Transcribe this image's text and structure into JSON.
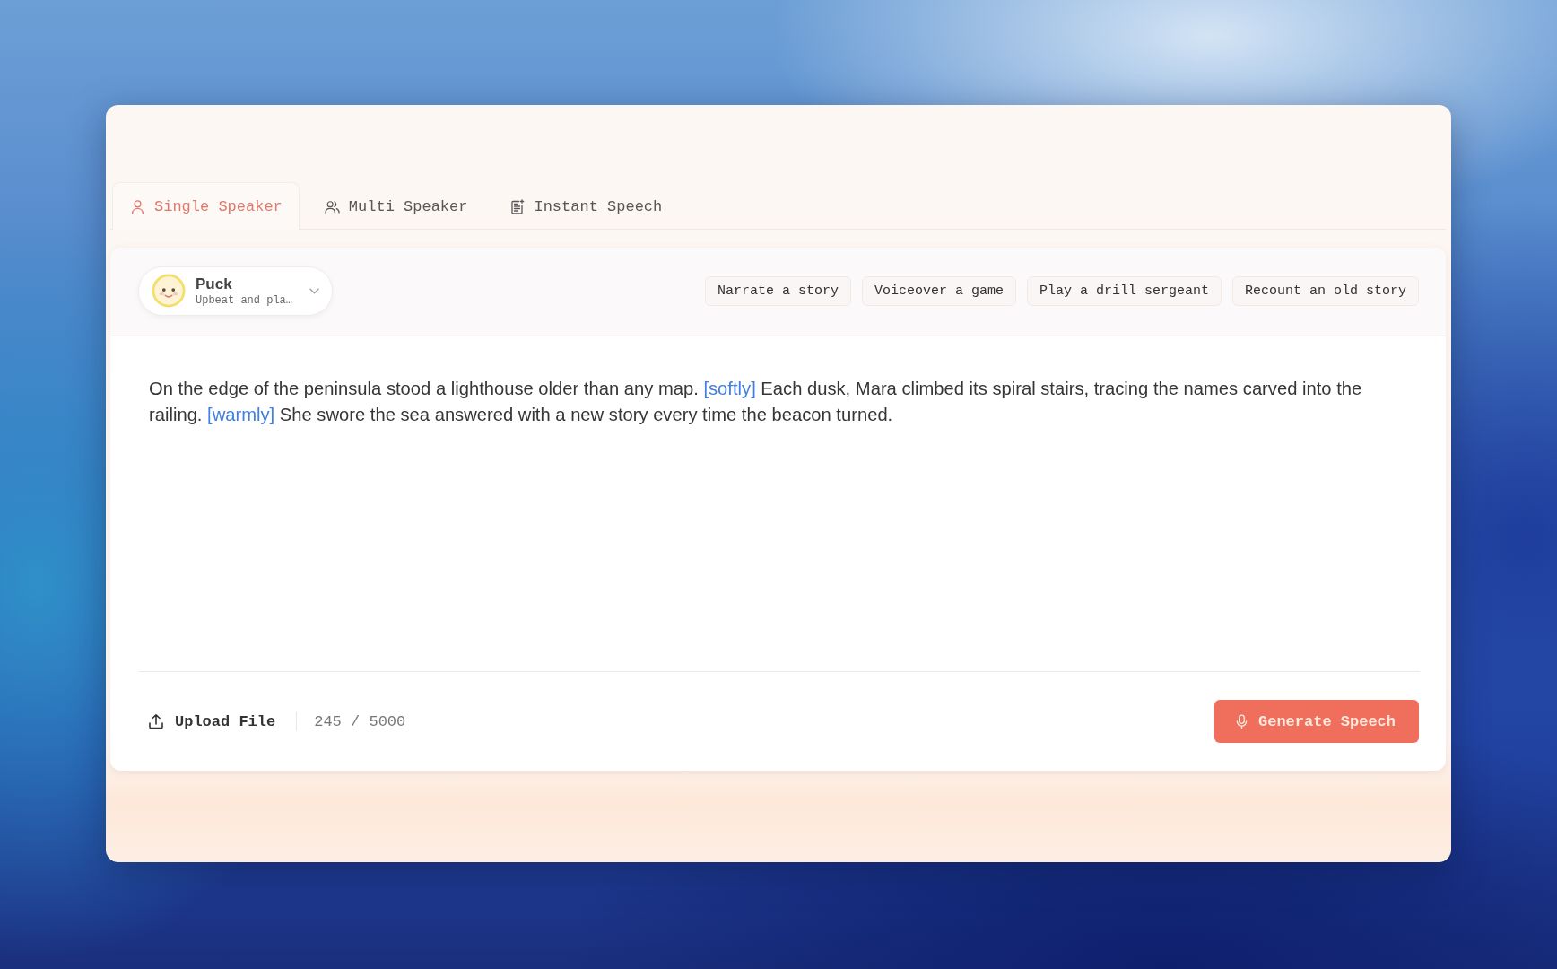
{
  "tabs": [
    {
      "label": "Single Speaker",
      "selected": true
    },
    {
      "label": "Multi Speaker",
      "selected": false
    },
    {
      "label": "Instant Speech",
      "selected": false
    }
  ],
  "voice": {
    "name": "Puck",
    "description": "Upbeat and pla…"
  },
  "style_prompts": [
    "Narrate a story",
    "Voiceover a game",
    "Play a drill sergeant",
    "Recount an old story"
  ],
  "script": [
    {
      "kind": "text",
      "text": "On the edge of the peninsula stood a lighthouse older than any map. "
    },
    {
      "kind": "tag",
      "text": "[softly]"
    },
    {
      "kind": "text",
      "text": " Each dusk, Mara climbed its spiral stairs, tracing the names carved into the railing. "
    },
    {
      "kind": "tag",
      "text": "[warmly]"
    },
    {
      "kind": "text",
      "text": " She swore the sea answered with a new story every time the beacon turned."
    }
  ],
  "footer": {
    "upload": "Upload File",
    "char_count": "245 / 5000",
    "generate": "Generate Speech"
  }
}
